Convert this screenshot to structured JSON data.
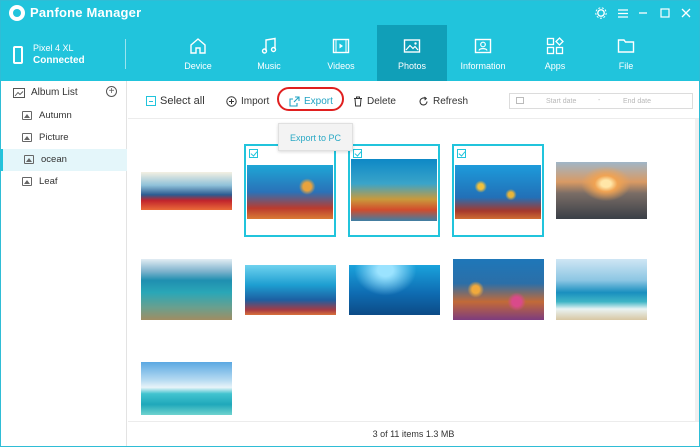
{
  "app": {
    "title": "Panfone Manager"
  },
  "device": {
    "name": "Pixel 4 XL",
    "status": "Connected"
  },
  "nav": {
    "tabs": [
      {
        "label": "Device",
        "icon": "home-icon"
      },
      {
        "label": "Music",
        "icon": "music-icon"
      },
      {
        "label": "Videos",
        "icon": "video-icon"
      },
      {
        "label": "Photos",
        "icon": "photo-icon",
        "active": true
      },
      {
        "label": "Information",
        "icon": "contact-card-icon"
      },
      {
        "label": "Apps",
        "icon": "apps-icon"
      },
      {
        "label": "File",
        "icon": "folder-icon"
      }
    ]
  },
  "sidebar": {
    "title": "Album List",
    "items": [
      {
        "label": "Autumn"
      },
      {
        "label": "Picture"
      },
      {
        "label": "ocean",
        "selected": true
      },
      {
        "label": "Leaf"
      }
    ]
  },
  "toolbar": {
    "select_all": "Select all",
    "import": "Import",
    "export": "Export",
    "delete": "Delete",
    "refresh": "Refresh",
    "start_date": "Start date",
    "end_date": "End date",
    "date_sep": "-"
  },
  "dropdown": {
    "export_to_pc": "Export to PC"
  },
  "status": {
    "text": "3 of 11 items 1.3 MB"
  },
  "colors": {
    "accent": "#21c4dc",
    "accent_active": "#109fb8",
    "highlight": "#e01f1f"
  }
}
